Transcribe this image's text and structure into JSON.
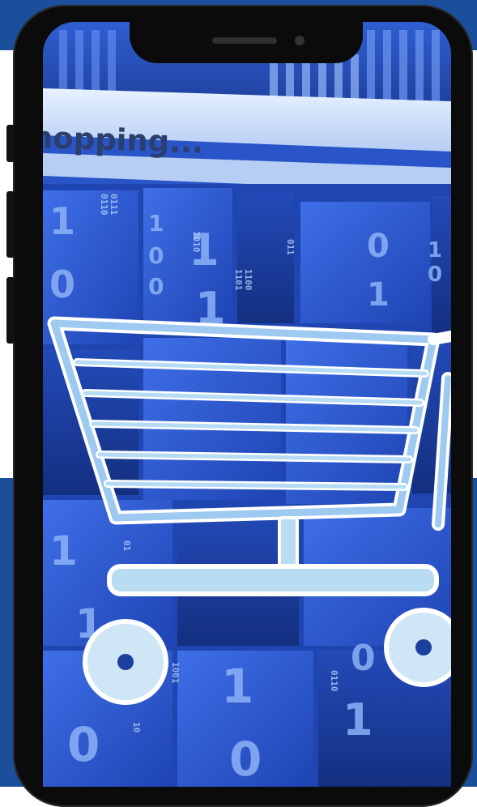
{
  "screen": {
    "label_text": "hopping...",
    "digits": [
      "1",
      "0",
      "1",
      "0",
      "0",
      "1",
      "1",
      "0",
      "1",
      "1",
      "0",
      "1",
      "1",
      "0",
      "1",
      "0",
      "1",
      "0"
    ],
    "binary_strings": [
      "0110",
      "0111",
      "1101",
      "1100",
      "1001",
      "0110",
      "01",
      "10",
      "011",
      "1010"
    ]
  },
  "colors": {
    "brand_blue": "#1b4f9c",
    "phone_frame": "#0b0b0b",
    "screen_blue": "#2a55c9",
    "cart_fill": "#b9dcf2",
    "cart_outline": "#ffffff"
  },
  "icons": [
    "shopping-cart-icon"
  ]
}
